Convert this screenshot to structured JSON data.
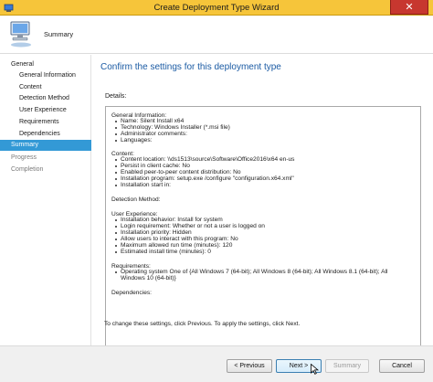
{
  "window": {
    "title": "Create Deployment Type Wizard",
    "close_symbol": "✕"
  },
  "header": {
    "title": "Summary",
    "icon": "computer-icon"
  },
  "nav": {
    "items": [
      {
        "label": "General",
        "level": "top"
      },
      {
        "label": "General Information",
        "level": "sub"
      },
      {
        "label": "Content",
        "level": "sub"
      },
      {
        "label": "Detection Method",
        "level": "sub"
      },
      {
        "label": "User Experience",
        "level": "sub"
      },
      {
        "label": "Requirements",
        "level": "sub"
      },
      {
        "label": "Dependencies",
        "level": "sub"
      },
      {
        "label": "Summary",
        "level": "top",
        "active": true
      },
      {
        "label": "Progress",
        "level": "top",
        "disabled": true
      },
      {
        "label": "Completion",
        "level": "top",
        "disabled": true
      }
    ]
  },
  "main": {
    "heading": "Confirm the settings for this deployment type",
    "details_label": "Details:",
    "details_lines": [
      "General Information:",
      "Name: Silent Install x64",
      "Technology: Windows Installer (*.msi file)",
      "Administrator comments:",
      "Languages:",
      "Content:",
      "Content location: \\\\ds1513\\source\\Software\\Office2016\\x64 en-us",
      "Persist in client cache: No",
      "Enabled peer-to-peer content distribution: No",
      "Installation program: setup.exe /configure \"configuration.x64.xml\"",
      "Installation start in:",
      "Detection Method:",
      "User Experience:",
      "Installation behavior: Install for system",
      "Login requirement: Whether or not a user is logged on",
      "Installation priority: Hidden",
      "Allow users to interact with this program: No",
      "Maximum allowed run time (minutes): 120",
      "Estimated install time (minutes): 0",
      "Requirements:",
      "Operating system  One of  {All Windows 7 (64-bit); All Windows 8 (64-bit); All Windows 8.1 (64-bit); All",
      "Windows 10 (64-bit)}",
      "Dependencies:"
    ],
    "footnote": "To change these settings, click Previous. To apply the settings, click Next."
  },
  "buttons": {
    "previous": "< Previous",
    "next": "Next >",
    "summary": "Summary",
    "cancel": "Cancel"
  }
}
